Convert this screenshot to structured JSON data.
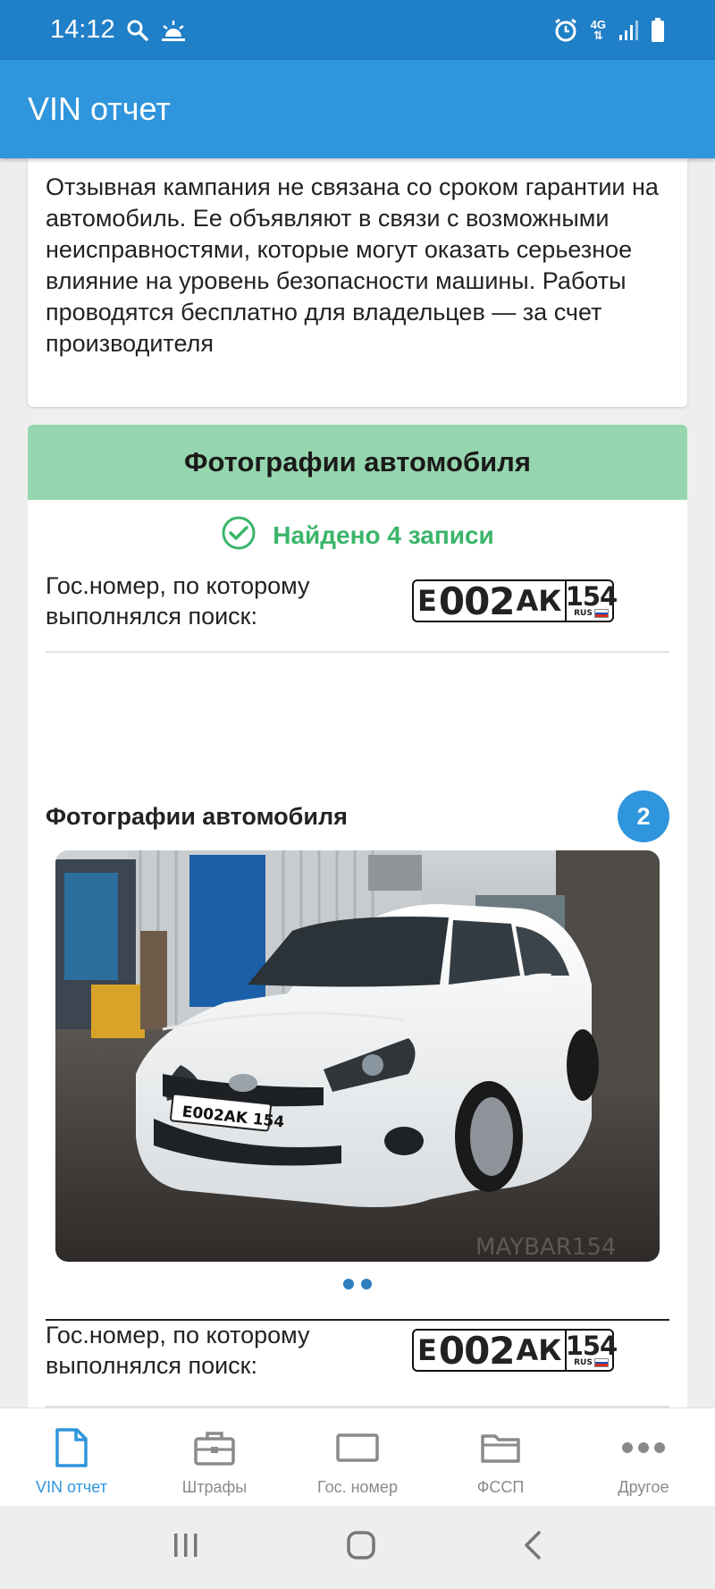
{
  "status_bar": {
    "time": "14:12",
    "network": "4G"
  },
  "app_bar": {
    "title": "VIN отчет"
  },
  "recall_card": {
    "text": "Отзывная кампания не связана со сроком гарантии на автомобиль. Ее объявляют в связи с возможными неисправностями, которые могут оказать серьезное влияние на уровень безопасности машины. Работы проводятся бесплатно для владельцев — за счет производителя"
  },
  "photos_card": {
    "header": "Фотографии автомобиля",
    "found_text": "Найдено 4 записи",
    "plate_label": "Гос.номер, по которому выполнялся поиск:",
    "plate": {
      "letter1": "Е",
      "number": "002",
      "letters2": "АК",
      "region": "154",
      "country": "RUS"
    },
    "photos_title": "Фотографии автомобиля",
    "photos_count": "2",
    "photo_watermark": "MAYBAR154",
    "second_plate_label": "Гос.номер, по которому выполнялся поиск:"
  },
  "bottom_nav": {
    "items": [
      {
        "label": "VIN отчет",
        "icon": "document-icon",
        "active": true
      },
      {
        "label": "Штрафы",
        "icon": "briefcase-icon",
        "active": false
      },
      {
        "label": "Гос. номер",
        "icon": "plate-icon",
        "active": false
      },
      {
        "label": "ФССП",
        "icon": "folder-icon",
        "active": false
      },
      {
        "label": "Другое",
        "icon": "more-icon",
        "active": false
      }
    ]
  },
  "colors": {
    "status_bar": "#1f7fc7",
    "app_bar": "#2f95dc",
    "section_header": "#96d6ae",
    "success": "#3ab56a",
    "accent": "#2f95dc"
  }
}
